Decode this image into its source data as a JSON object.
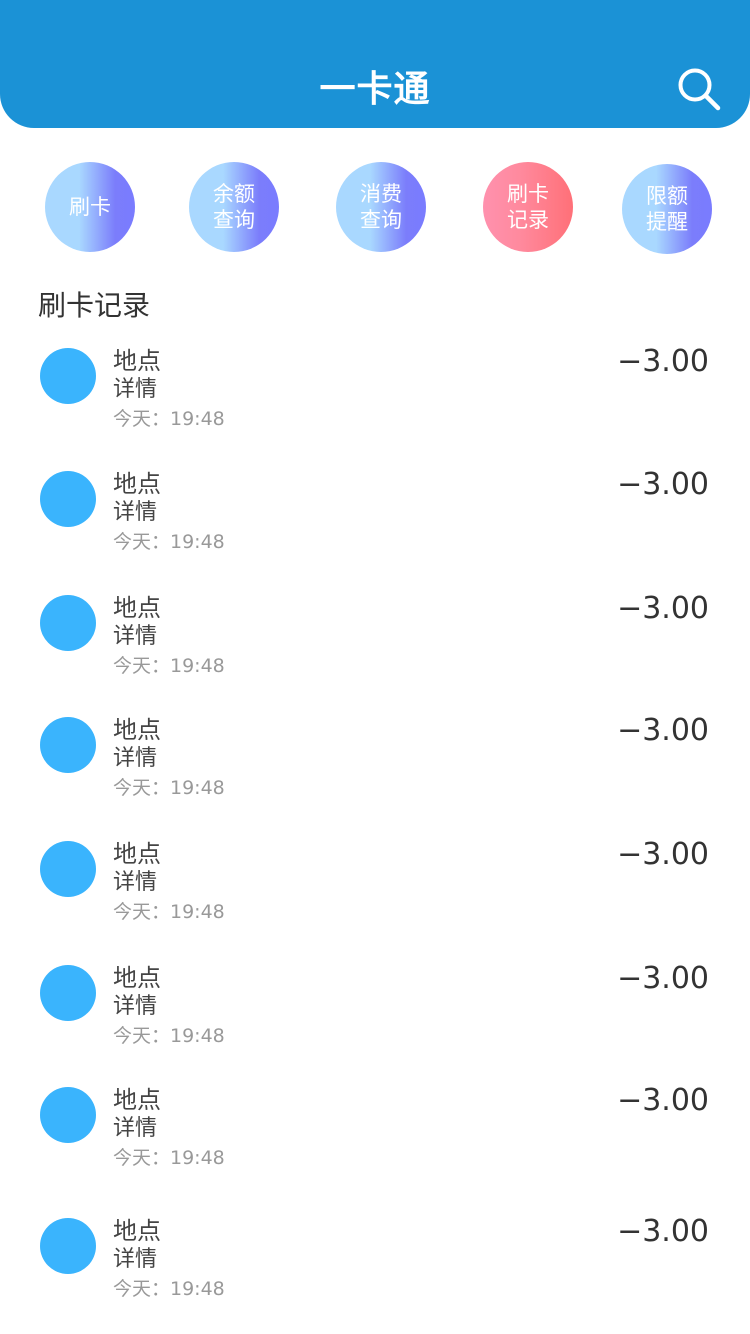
{
  "header": {
    "title": "一卡通",
    "search_icon": "search-icon",
    "bg_color": "#1b92d6"
  },
  "shortcuts": [
    {
      "label": "刷卡",
      "style": "blue"
    },
    {
      "label": "余额查询",
      "style": "blue"
    },
    {
      "label": "消费查询",
      "style": "blue"
    },
    {
      "label": "刷卡记录",
      "style": "pink"
    },
    {
      "label": "限额提醒",
      "style": "blue"
    }
  ],
  "records_section": {
    "title": "刷卡记录"
  },
  "records": [
    {
      "place": "地点",
      "detail": "详情",
      "time": "今天：19:48",
      "amount": "−3.00"
    },
    {
      "place": "地点",
      "detail": "详情",
      "time": "今天：19:48",
      "amount": "−3.00"
    },
    {
      "place": "地点",
      "detail": "详情",
      "time": "今天：19:48",
      "amount": "−3.00"
    },
    {
      "place": "地点",
      "detail": "详情",
      "time": "今天：19:48",
      "amount": "−3.00"
    },
    {
      "place": "地点",
      "detail": "详情",
      "time": "今天：19:48",
      "amount": "−3.00"
    },
    {
      "place": "地点",
      "detail": "详情",
      "time": "今天：19:48",
      "amount": "−3.00"
    },
    {
      "place": "地点",
      "detail": "详情",
      "time": "今天：19:48",
      "amount": "−3.00"
    },
    {
      "place": "地点",
      "detail": "详情",
      "time": "今天：19:48",
      "amount": "−3.00"
    }
  ],
  "colors": {
    "avatar": "#3ab4fd",
    "text_primary": "#333333",
    "text_secondary": "#999999"
  }
}
